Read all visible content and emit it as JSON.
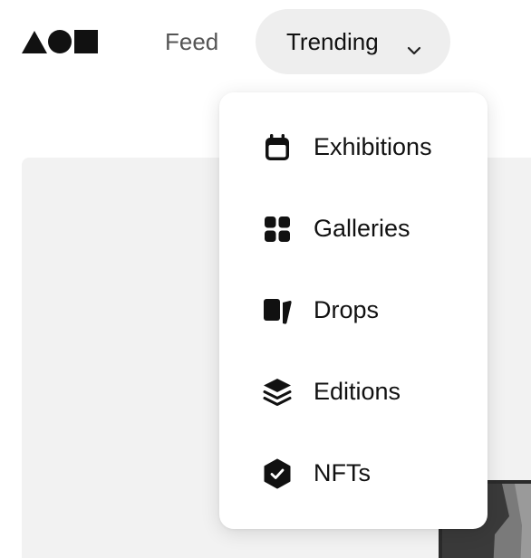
{
  "header": {
    "logo_icon": "aoe-shapes-logo",
    "nav": {
      "feed_label": "Feed",
      "trending_label": "Trending"
    }
  },
  "dropdown": {
    "items": [
      {
        "label": "Exhibitions",
        "icon": "calendar-icon"
      },
      {
        "label": "Galleries",
        "icon": "grid-icon"
      },
      {
        "label": "Drops",
        "icon": "drops-icon"
      },
      {
        "label": "Editions",
        "icon": "layers-icon"
      },
      {
        "label": "NFTs",
        "icon": "badge-check-icon"
      }
    ]
  },
  "colors": {
    "text": "#111111",
    "muted_text": "#555555",
    "pill_bg": "#eeeeee",
    "panel_bg": "#f2f2f2"
  }
}
